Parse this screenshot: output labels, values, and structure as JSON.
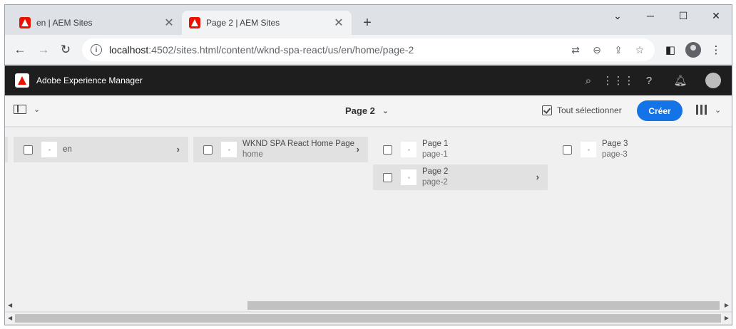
{
  "browser": {
    "tabs": [
      {
        "title": "en | AEM Sites",
        "active": false
      },
      {
        "title": "Page 2 | AEM Sites",
        "active": true
      }
    ],
    "new_tab_symbol": "+",
    "url_host": "localhost",
    "url_rest": ":4502/sites.html/content/wknd-spa-react/us/en/home/page-2"
  },
  "aem": {
    "product_name": "Adobe Experience Manager",
    "breadcrumb_title": "Page 2",
    "select_all_label": "Tout sélectionner",
    "create_label": "Créer"
  },
  "columns": [
    {
      "items": [
        {
          "title": "en",
          "subtitle": "",
          "selected": true,
          "has_children": true
        }
      ]
    },
    {
      "items": [
        {
          "title": "WKND SPA React Home Page",
          "subtitle": "home",
          "selected": true,
          "has_children": true
        }
      ]
    },
    {
      "items": [
        {
          "title": "Page 1",
          "subtitle": "page-1",
          "selected": false,
          "has_children": false
        },
        {
          "title": "Page 2",
          "subtitle": "page-2",
          "selected": true,
          "has_children": true
        }
      ]
    },
    {
      "items": [
        {
          "title": "Page 3",
          "subtitle": "page-3",
          "selected": false,
          "has_children": false
        }
      ]
    }
  ],
  "colors": {
    "aem_header_bg": "#1e1e1e",
    "create_button": "#1473e6",
    "adobe_red": "#eb1000"
  }
}
